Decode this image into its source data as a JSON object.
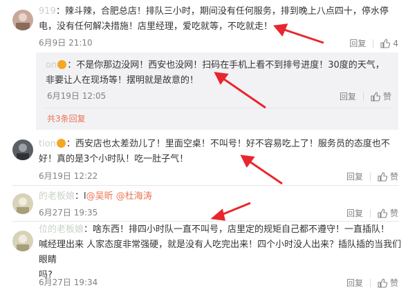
{
  "comments": [
    {
      "username": "919",
      "text_line1": "：辣斗辣，合肥总店！排队三小时，期间没有任何服务，排到晚上八点四十，停水停",
      "text_line2": "电，没有任何解决措施！店里经理，爱吃就等，不吃就走！",
      "time": "6月9日 21:10",
      "reply_label": "回复",
      "like_count": "4"
    },
    {
      "username": "on",
      "text_line1": "：不是你那边没网！西安也没网！扫码在手机上看不到排号进度！30度的天气，",
      "text_line2": "非要让人在现场等！摆明就是故意的！",
      "time": "6月19日 12:05",
      "reply_label": "回复",
      "like_label": "赞"
    },
    {
      "more_replies": "共3条回复"
    },
    {
      "username": "tion",
      "text_line1": "：西安店也太差劲儿了！里面空桌！不叫号！好不容易吃上了！服务员的态度也不",
      "text_line2": "好！真的是3个小时队！吃一肚子气！",
      "time": "6月19日 12:22",
      "reply_label": "回复",
      "like_label": "赞"
    },
    {
      "username": "的老板娘",
      "text_prefix": "：l",
      "mention1": "@吴昕",
      "mention2": "@杜海涛",
      "time": "6月27日 19:35",
      "reply_label": "回复",
      "like_label": "赞"
    },
    {
      "username": "位的老板娘",
      "text_line1": "：啥东西！排四小时队一直不叫号，店里定的规矩自己都不遵守！一直插队！",
      "text_line2": "喊经理出来 人家态度非常强硬，就是没有人吃完出来！四个小时没人出来？插队插的当我们眼睛",
      "text_line3": "吗?",
      "time": "6月27日 19:34",
      "reply_label": "回复",
      "like_label": "赞"
    }
  ],
  "colors": {
    "accent": "#eb7350",
    "arrow": "#e8262d",
    "meta": "#808080"
  }
}
